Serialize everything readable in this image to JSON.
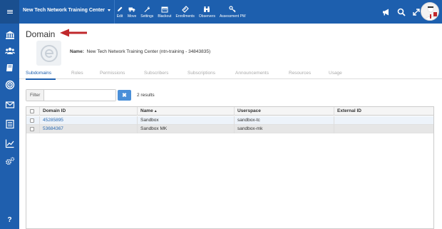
{
  "topbar": {
    "org_name": "New Tech Network Training Center",
    "tools": [
      {
        "label": "Edit",
        "icon": "pencil-icon"
      },
      {
        "label": "Move",
        "icon": "truck-icon"
      },
      {
        "label": "Settings",
        "icon": "wrench-icon"
      },
      {
        "label": "Blackout",
        "icon": "calendar-icon"
      },
      {
        "label": "Enrollments",
        "icon": "ticket-icon"
      },
      {
        "label": "Observers",
        "icon": "binoculars-icon"
      },
      {
        "label": "Assessment PW",
        "icon": "key-icon"
      }
    ],
    "right_icons": [
      "megaphone-icon",
      "search-icon",
      "expand-icon"
    ]
  },
  "sidebar": {
    "icons": [
      "institution-icon",
      "users-icon",
      "book-icon",
      "target-icon",
      "envelope-icon",
      "list-icon",
      "chart-icon",
      "cogs-icon"
    ],
    "help_label": "?"
  },
  "page": {
    "title": "Domain",
    "name_label": "Name:",
    "name_value": "New Tech Network Training Center (ntn-training - 34843835)"
  },
  "tabs": [
    {
      "label": "Subdomains",
      "active": true
    },
    {
      "label": "Roles",
      "active": false
    },
    {
      "label": "Permissions",
      "active": false
    },
    {
      "label": "Subscribers",
      "active": false
    },
    {
      "label": "Subscriptions",
      "active": false
    },
    {
      "label": "Announcements",
      "active": false
    },
    {
      "label": "Resources",
      "active": false
    },
    {
      "label": "Usage",
      "active": false
    }
  ],
  "filter": {
    "label": "Filter",
    "value": "",
    "placeholder": "",
    "clear_label": "✖",
    "results_text": "2 results"
  },
  "table": {
    "columns": [
      "Domain ID",
      "Name",
      "Userspace",
      "External ID"
    ],
    "sort_indicator": "▲",
    "rows": [
      {
        "domain_id": "45285895",
        "name": "Sandbox",
        "userspace": "sandbox-tc",
        "external_id": ""
      },
      {
        "domain_id": "53684367",
        "name": "Sandbox MK",
        "userspace": "sandbox-mk",
        "external_id": ""
      }
    ]
  },
  "colors": {
    "topbar": "#1d5fae",
    "sidebar": "#1f5fae",
    "link": "#2a6ab2",
    "arrow": "#c0282c",
    "clear_button": "#4a8fd8"
  }
}
